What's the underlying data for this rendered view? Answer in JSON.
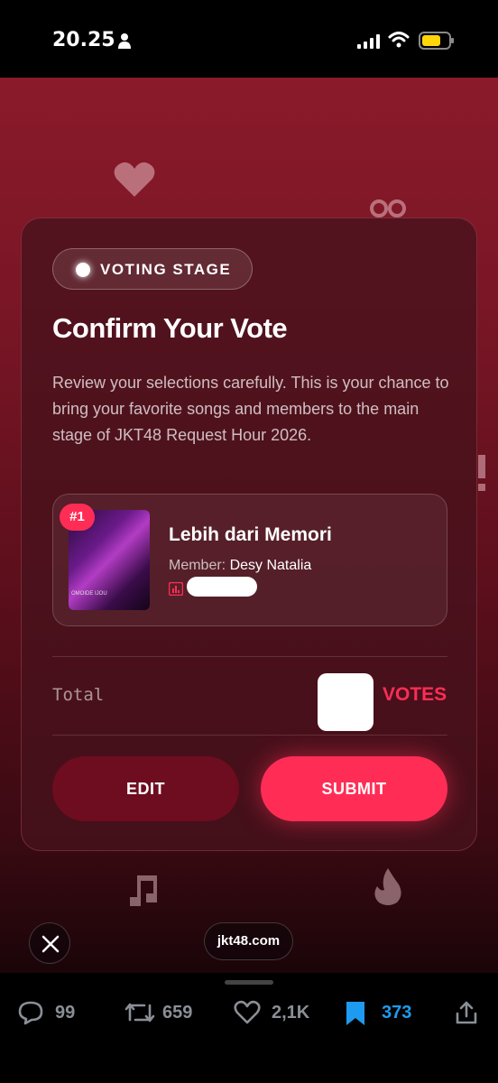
{
  "status_bar": {
    "time": "20.25"
  },
  "card": {
    "stage_label": "VOTING STAGE",
    "title": "Confirm Your Vote",
    "description": "Review your selections carefully. This is your chance to bring your favorite songs and members to the main stage of JKT48 Request Hour 2026.",
    "item": {
      "rank": "#1",
      "song": "Lebih dari Memori",
      "member_label": "Member:",
      "member_name": "Desy Natalia",
      "thumb_caption": "OMOIDE IJOU"
    },
    "total_label": "Total",
    "votes_label": "VOTES",
    "edit_label": "EDIT",
    "submit_label": "SUBMIT"
  },
  "browser": {
    "url": "jkt48.com"
  },
  "actions": {
    "replies": "99",
    "reposts": "659",
    "likes": "2,1K",
    "bookmarks": "373"
  },
  "colors": {
    "accent": "#ff2d55",
    "edit": "#6e0c20",
    "bookmark": "#1d9bf0"
  }
}
